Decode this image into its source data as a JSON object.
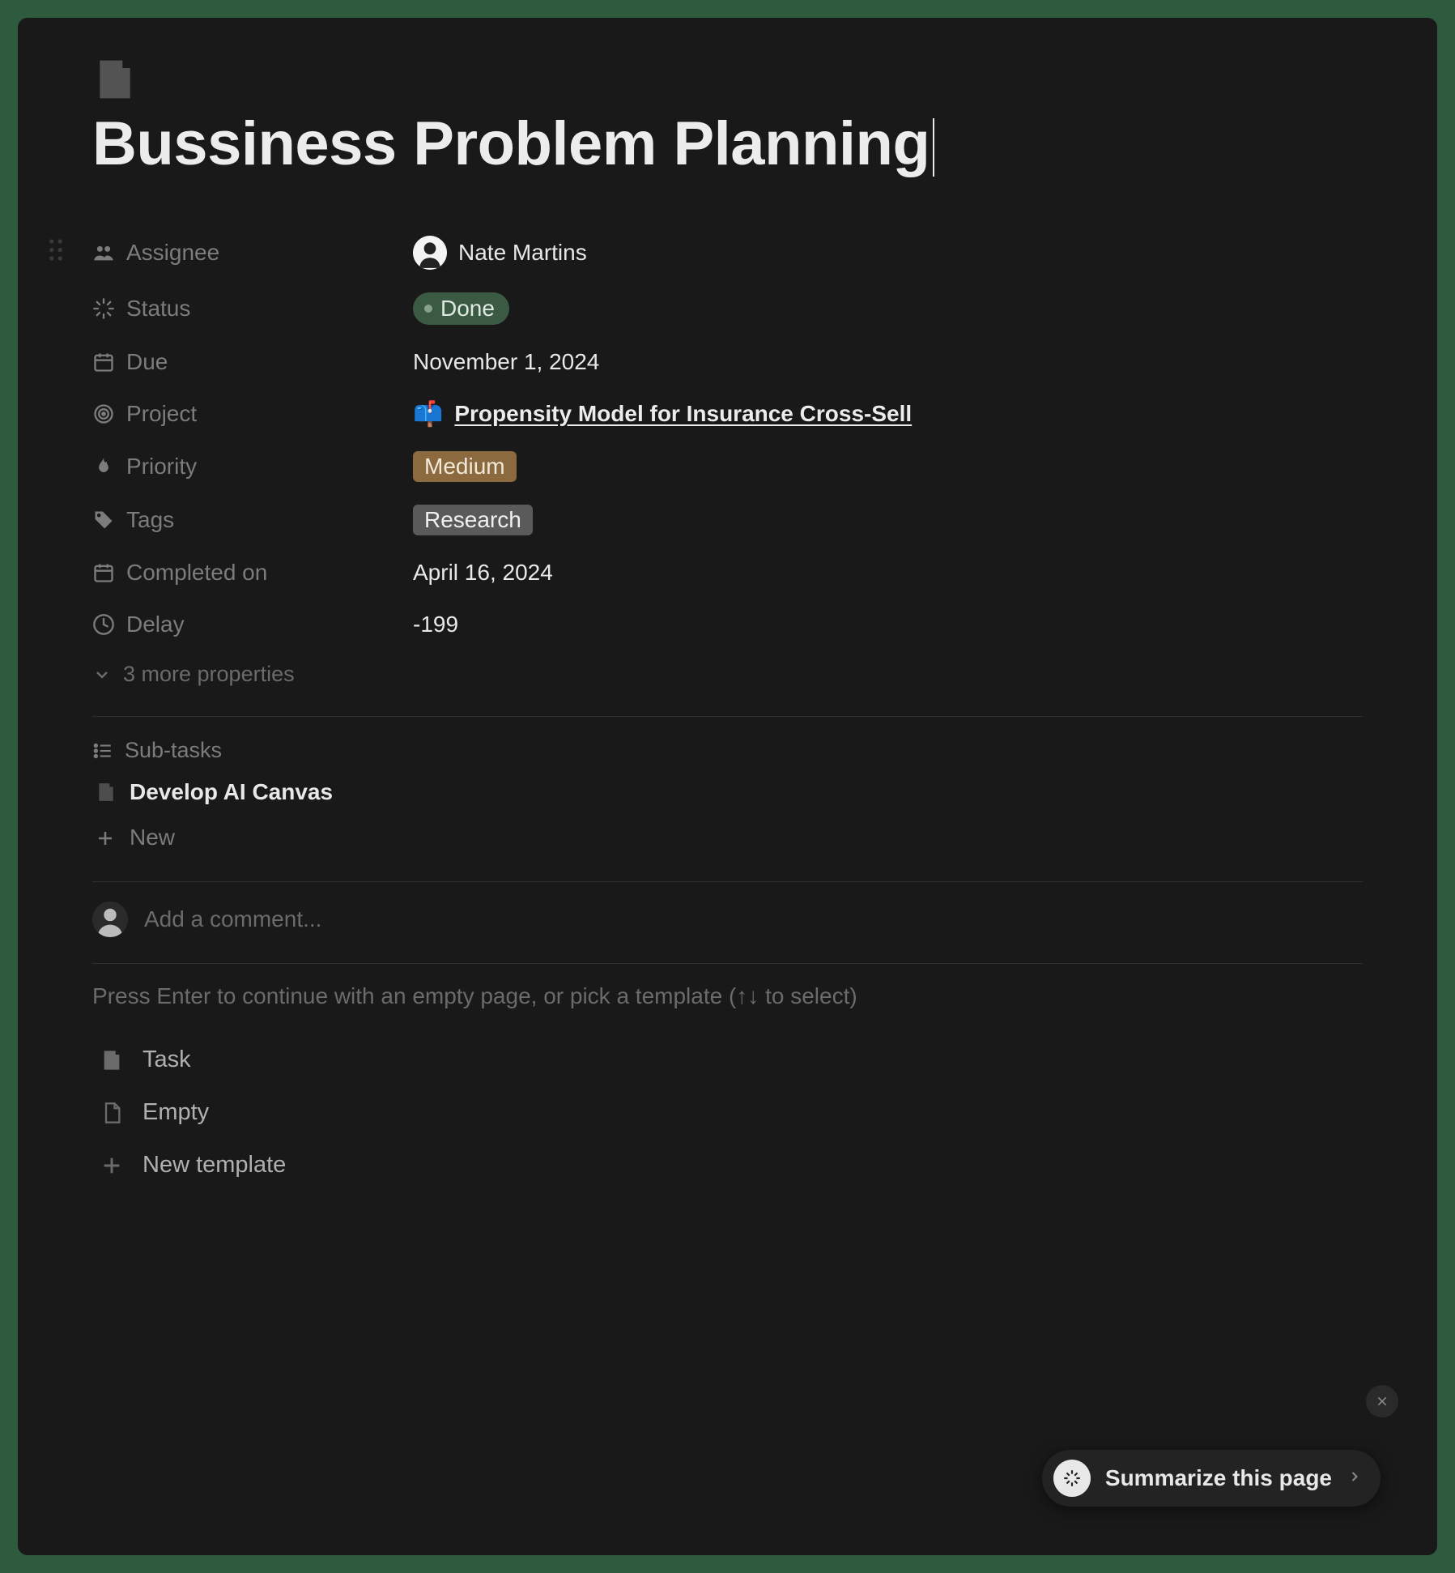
{
  "page": {
    "title": "Bussiness Problem Planning"
  },
  "properties": {
    "assignee": {
      "label": "Assignee",
      "value": "Nate Martins"
    },
    "status": {
      "label": "Status",
      "value": "Done"
    },
    "due": {
      "label": "Due",
      "value": "November 1, 2024"
    },
    "project": {
      "label": "Project",
      "icon": "📫",
      "value": "Propensity Model for Insurance Cross-Sell"
    },
    "priority": {
      "label": "Priority",
      "value": "Medium"
    },
    "tags": {
      "label": "Tags",
      "value": "Research"
    },
    "completed": {
      "label": "Completed on",
      "value": "April 16, 2024"
    },
    "delay": {
      "label": "Delay",
      "value": "-199"
    },
    "more": "3 more properties"
  },
  "subtasks": {
    "label": "Sub-tasks",
    "items": [
      "Develop AI Canvas"
    ],
    "new": "New"
  },
  "comment": {
    "placeholder": "Add a comment..."
  },
  "hint": "Press Enter to continue with an empty page, or pick a template (↑↓ to select)",
  "templates": {
    "task": "Task",
    "empty": "Empty",
    "new": "New template"
  },
  "summarize": {
    "label": "Summarize this page"
  }
}
